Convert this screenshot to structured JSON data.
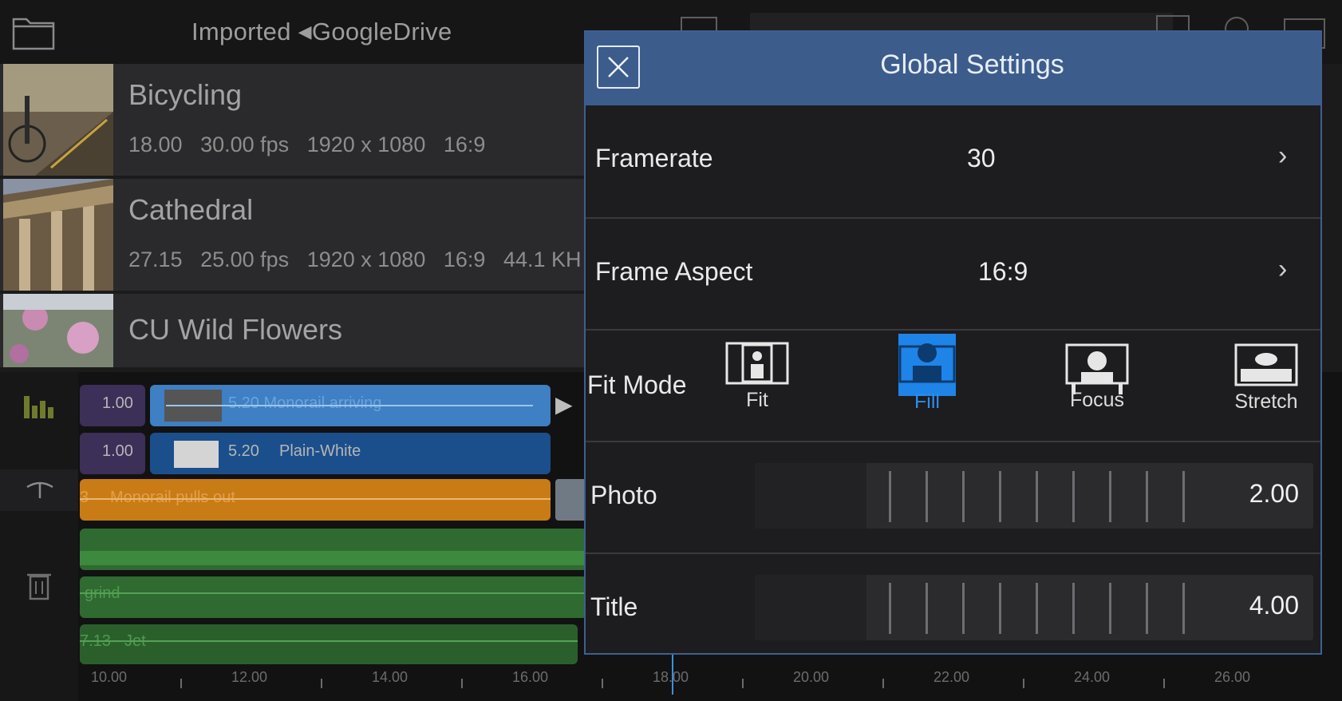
{
  "header": {
    "folder": "Imported",
    "location": "GoogleDrive"
  },
  "media": [
    {
      "title": "Bicycling",
      "duration": "18.00",
      "fps": "30.00 fps",
      "resolution": "1920 x 1080",
      "aspect": "16:9",
      "audio": ""
    },
    {
      "title": "Cathedral",
      "duration": "27.15",
      "fps": "25.00 fps",
      "resolution": "1920 x 1080",
      "aspect": "16:9",
      "audio": "44.1 KH"
    },
    {
      "title": "CU Wild Flowers"
    }
  ],
  "timeline": {
    "clips": {
      "video1_left": "1.00",
      "video1": "5.20 Monorail arriving",
      "video2_left": "1.00",
      "video2_dur": "5.20",
      "video2_name": "Plain-White",
      "orange_prefix": "3",
      "orange": "Monorail pulls out",
      "audio2": "grind",
      "audio3_dur": "7.13",
      "audio3_name": "Jet"
    },
    "ruler": [
      "10.00",
      "12.00",
      "14.00",
      "16.00",
      "18.00",
      "20.00",
      "22.00",
      "24.00",
      "26.00"
    ]
  },
  "dialog": {
    "title": "Global Settings",
    "framerate": {
      "label": "Framerate",
      "value": "30"
    },
    "frame_aspect": {
      "label": "Frame Aspect",
      "value": "16:9"
    },
    "fit_mode": {
      "label": "Fit Mode",
      "options": [
        "Fit",
        "Fill",
        "Focus",
        "Stretch"
      ],
      "selected": "Fill"
    },
    "photo": {
      "label": "Photo",
      "value": "2.00"
    },
    "title_row": {
      "label": "Title",
      "value": "4.00"
    }
  },
  "colors": {
    "accent": "#3d8fe0",
    "header": "#3c5c8c",
    "clip_blue": "#2a5a98",
    "clip_orange": "#d98b1c",
    "clip_green": "#2f6a31"
  }
}
